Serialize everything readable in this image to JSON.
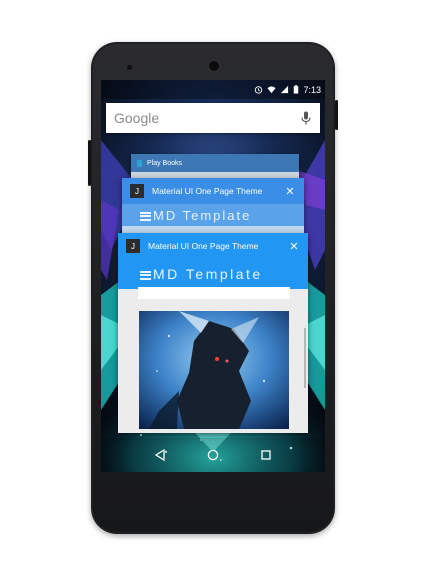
{
  "statusbar": {
    "time": "7:13"
  },
  "search": {
    "logo_text": "Google"
  },
  "recents": {
    "back_card": {
      "title": "Play Books"
    },
    "mid_card": {
      "icon_letter": "J",
      "title": "Material UI One Page Theme",
      "banner": "MD Template"
    },
    "front_card": {
      "icon_letter": "J",
      "title": "Material UI One Page Theme",
      "banner": "MD Template"
    }
  },
  "colors": {
    "accent": "#2196f3",
    "card_header_mid": "#3a8ee6",
    "teal_glow": "#2fd6c8"
  },
  "icons": [
    "alarm-icon",
    "wifi-icon",
    "signal-icon",
    "battery-icon",
    "mic-icon",
    "close-icon",
    "back-icon",
    "home-icon",
    "recents-icon"
  ]
}
